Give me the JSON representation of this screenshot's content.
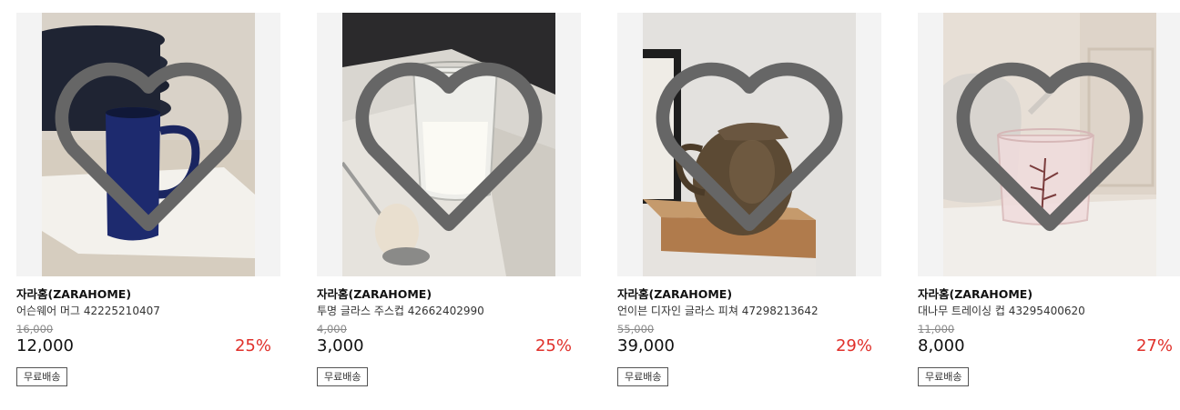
{
  "products": [
    {
      "brand": "자라홈(ZARAHOME)",
      "name": "어슨웨어 머그 42225210407",
      "original_price": "16,000",
      "price": "12,000",
      "discount": "25%",
      "shipping_badge": "무료배송",
      "image_alt": "dark blue mug"
    },
    {
      "brand": "자라홈(ZARAHOME)",
      "name": "투명 글라스 주스컵 42662402990",
      "original_price": "4,000",
      "price": "3,000",
      "discount": "25%",
      "shipping_badge": "무료배송",
      "image_alt": "clear glass juice cup"
    },
    {
      "brand": "자라홈(ZARAHOME)",
      "name": "언이븐 디자인 글라스 피쳐 47298213642",
      "original_price": "55,000",
      "price": "39,000",
      "discount": "29%",
      "shipping_badge": "무료배송",
      "image_alt": "amber glass pitcher"
    },
    {
      "brand": "자라홈(ZARAHOME)",
      "name": "대나무 트레이싱 컵 43295400620",
      "original_price": "11,000",
      "price": "8,000",
      "discount": "27%",
      "shipping_badge": "무료배송",
      "image_alt": "pink glass with bamboo print"
    }
  ],
  "colors": {
    "discount": "#e0302a",
    "thumb_background": "#f3f3f3"
  },
  "icons": {
    "wishlist": "heart-outline-icon"
  }
}
